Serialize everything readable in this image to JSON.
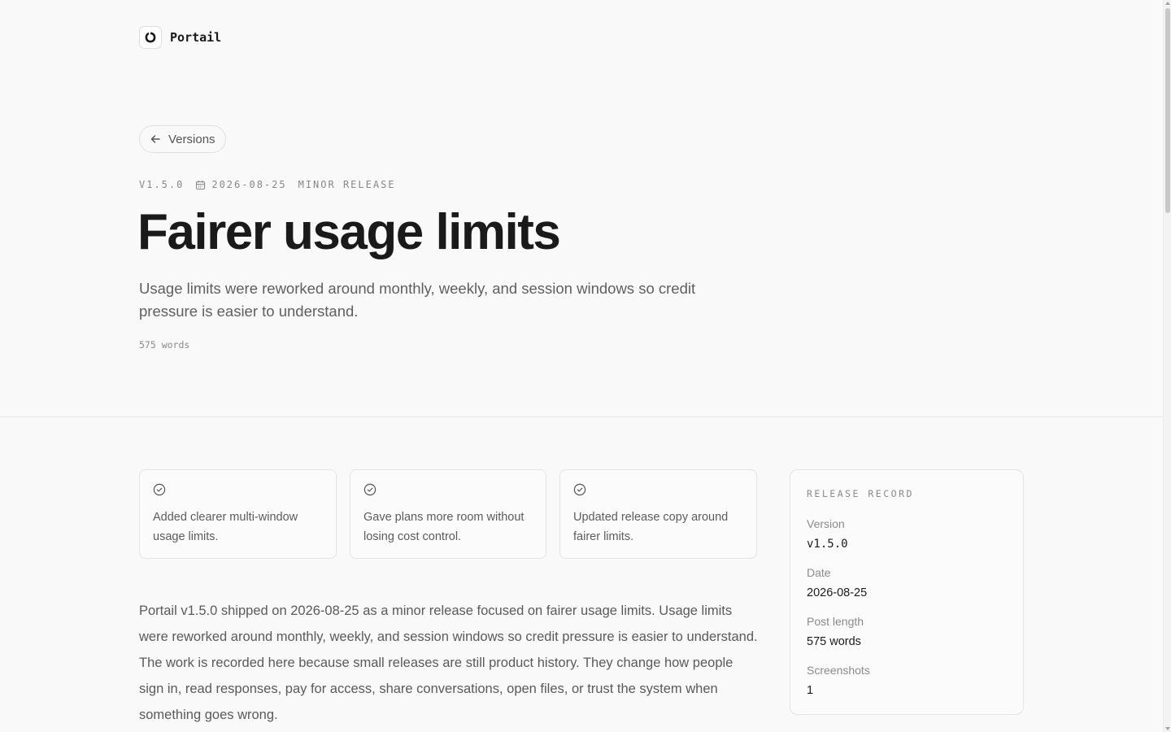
{
  "brand": {
    "name": "Portail"
  },
  "nav": {
    "back_label": "Versions"
  },
  "meta": {
    "version": "V1.5.0",
    "date": "2026-08-25",
    "release_type": "MINOR RELEASE"
  },
  "post": {
    "title": "Fairer usage limits",
    "subtitle": "Usage limits were reworked around monthly, weekly, and session windows so credit pressure is easier to understand.",
    "word_count": "575 words",
    "body": "Portail v1.5.0 shipped on 2026-08-25 as a minor release focused on fairer usage limits. Usage limits were reworked around monthly, weekly, and session windows so credit pressure is easier to understand. The work is recorded here because small releases are still product history. They change how people sign in, read responses, pay for access, share conversations, open files, or trust the system when something goes wrong."
  },
  "highlights": [
    {
      "text": "Added clearer multi-window usage limits.",
      "icon": "check-circle-icon"
    },
    {
      "text": "Gave plans more room without losing cost control.",
      "icon": "check-circle-icon"
    },
    {
      "text": "Updated release copy around fairer limits.",
      "icon": "check-circle-icon"
    }
  ],
  "release_record": {
    "heading": "RELEASE RECORD",
    "rows": [
      {
        "label": "Version",
        "value": "v1.5.0"
      },
      {
        "label": "Date",
        "value": "2026-08-25"
      },
      {
        "label": "Post length",
        "value": "575 words"
      },
      {
        "label": "Screenshots",
        "value": "1"
      }
    ]
  },
  "colors": {
    "background": "#f9f9f9",
    "text": "#1a1a1a",
    "muted": "#8a8a8a",
    "border": "#e3e3e3"
  }
}
